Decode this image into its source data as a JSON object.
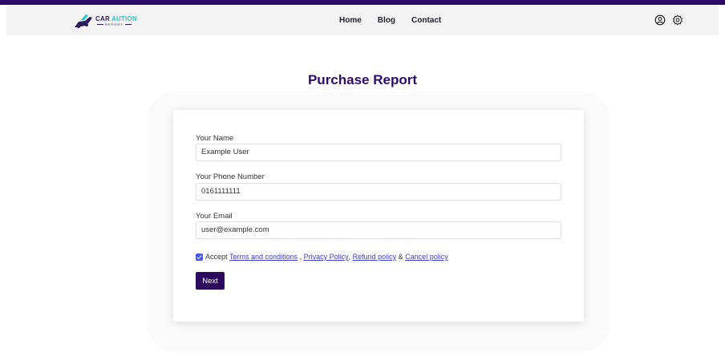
{
  "header": {
    "logo": {
      "brand": "CAR ",
      "brand_accent": "AUTION",
      "tagline": "REPORT"
    },
    "nav": [
      {
        "label": "Home"
      },
      {
        "label": "Blog"
      },
      {
        "label": "Contact"
      }
    ],
    "icons": [
      "user-circle-icon",
      "settings-gear-icon"
    ]
  },
  "page": {
    "title": "Purchase Report"
  },
  "form": {
    "name": {
      "label": "Your Name",
      "value": "Example User"
    },
    "phone": {
      "label": "Your Phone Number",
      "value": "0161111111"
    },
    "email": {
      "label": "Your Email",
      "value": "user@example.com"
    },
    "accept": {
      "checked": true,
      "prefix": "Accept ",
      "terms": "Terms and conditions",
      "sep1": " , ",
      "privacy": "Privacy Policy",
      "sep2": ", ",
      "refund": "Refund policy",
      "sep3": " & ",
      "cancel": "Cancel policy"
    },
    "submit_label": "Next"
  },
  "colors": {
    "brand": "#2d0b6b",
    "accent": "#27c6c8",
    "button": "#2d0b5e",
    "link": "#3a40c9"
  }
}
